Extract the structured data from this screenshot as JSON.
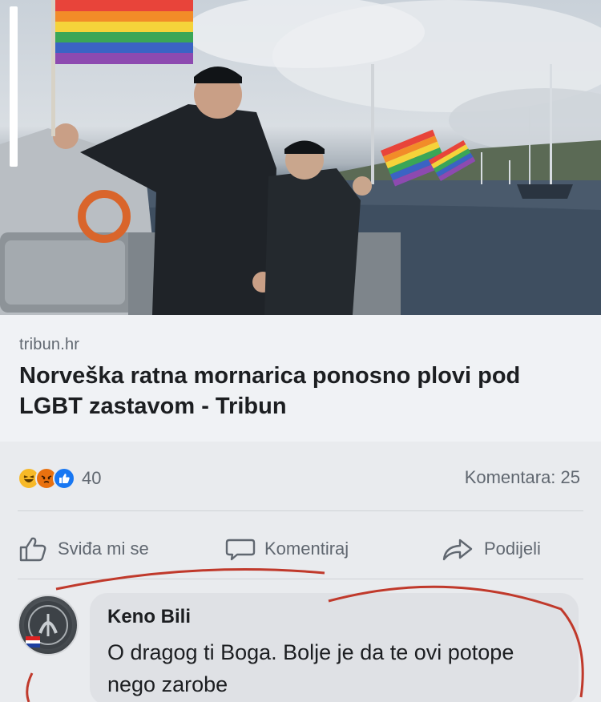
{
  "post": {
    "link": {
      "domain": "tribun.hr",
      "title": "Norveška ratna mornarica ponosno plovi pod LGBT zastavom - Tribun"
    },
    "reactions": {
      "icons": [
        "haha-reaction-icon",
        "angry-reaction-icon",
        "like-reaction-icon"
      ],
      "count": "40"
    },
    "comments_summary": "Komentara: 25",
    "actions": {
      "like": "Sviđa mi se",
      "comment": "Komentiraj",
      "share": "Podijeli"
    }
  },
  "comment": {
    "author": "Keno Bili",
    "text": "O dragog ti Boga. Bolje je da te ovi potope nego zarobe"
  },
  "colors": {
    "facebook_blue": "#1877f2",
    "haha_yellow": "#f7b928",
    "angry_orange": "#e9710f",
    "scribble_red": "#c0392b",
    "text_secondary": "#606770"
  }
}
